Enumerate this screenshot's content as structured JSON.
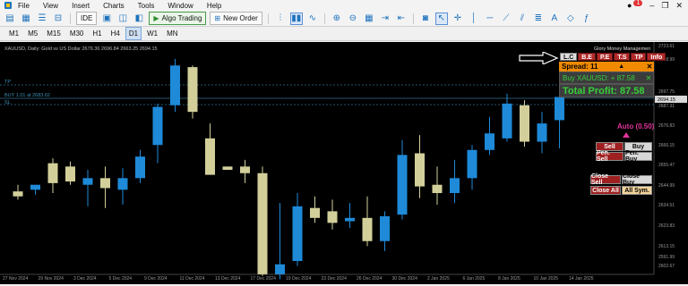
{
  "menu": {
    "items": [
      "File",
      "View",
      "Insert",
      "Charts",
      "Tools",
      "Window",
      "Help"
    ],
    "notification_count": "1"
  },
  "toolbar": {
    "ide_label": "IDE",
    "algo_trading_label": "Algo Trading",
    "new_order_label": "New Order"
  },
  "timeframes": {
    "items": [
      "M1",
      "M5",
      "M15",
      "M30",
      "H1",
      "H4",
      "D1",
      "W1",
      "MN"
    ],
    "active": "D1"
  },
  "chart": {
    "header": "XAUUSD, Daily: Gold vs US Dollar 2679.36 2696.84 2663.25 2694.15",
    "ea_name": "Glory Money Managemen",
    "tp_label": "TP",
    "buy_line_label": "BUY 1.01 at 2683.62",
    "sl_label": "SL",
    "current_price_tag": "2694.15",
    "price_labels": [
      "2723.61",
      "2718.99",
      "2697.75",
      "2687.31",
      "2676.83",
      "2666.15",
      "2655.47",
      "2644.99",
      "2634.51",
      "2623.83",
      "2613.15",
      "2602.67",
      "2591.99"
    ],
    "date_labels": [
      "27 Nov 2024",
      "29 Nov 2024",
      "3 Dec 2024",
      "5 Dec 2024",
      "9 Dec 2024",
      "11 Dec 2024",
      "13 Dec 2024",
      "17 Dec 2024",
      "19 Dec 2024",
      "23 Dec 2024",
      "26 Dec 2024",
      "30 Dec 2024",
      "2 Jan 2025",
      "6 Jan 2025",
      "8 Jan 2025",
      "10 Jan 2025",
      "14 Jan 2025"
    ],
    "colors": {
      "bull": "#1e8ad8",
      "bear": "#d2cf9a",
      "background": "#000000",
      "tp_line": "#2f6f8f",
      "buy_line": "#2f6f8f"
    }
  },
  "chart_data": {
    "type": "candlestick",
    "ylim": [
      2588,
      2725
    ],
    "candles": [
      {
        "o": 2637,
        "h": 2641,
        "l": 2632,
        "c": 2634
      },
      {
        "o": 2638,
        "h": 2640,
        "l": 2635,
        "c": 2641
      },
      {
        "o": 2654,
        "h": 2657,
        "l": 2636,
        "c": 2642
      },
      {
        "o": 2652,
        "h": 2655,
        "l": 2641,
        "c": 2643
      },
      {
        "o": 2641,
        "h": 2650,
        "l": 2628,
        "c": 2645
      },
      {
        "o": 2645,
        "h": 2652,
        "l": 2627,
        "c": 2639
      },
      {
        "o": 2638,
        "h": 2651,
        "l": 2629,
        "c": 2645
      },
      {
        "o": 2645,
        "h": 2662,
        "l": 2642,
        "c": 2658
      },
      {
        "o": 2665,
        "h": 2690,
        "l": 2654,
        "c": 2688
      },
      {
        "o": 2689,
        "h": 2717,
        "l": 2685,
        "c": 2713
      },
      {
        "o": 2712,
        "h": 2713,
        "l": 2681,
        "c": 2685
      },
      {
        "o": 2669,
        "h": 2678,
        "l": 2652,
        "c": 2647
      },
      {
        "o": 2652,
        "h": 2652,
        "l": 2650,
        "c": 2650
      },
      {
        "o": 2652,
        "h": 2656,
        "l": 2642,
        "c": 2648
      },
      {
        "o": 2648,
        "h": 2652,
        "l": 2586,
        "c": 2587
      },
      {
        "o": 2587,
        "h": 2630,
        "l": 2584,
        "c": 2593
      },
      {
        "o": 2595,
        "h": 2636,
        "l": 2592,
        "c": 2628
      },
      {
        "o": 2627,
        "h": 2634,
        "l": 2618,
        "c": 2621
      },
      {
        "o": 2625,
        "h": 2632,
        "l": 2614,
        "c": 2618
      },
      {
        "o": 2619,
        "h": 2630,
        "l": 2615,
        "c": 2621
      },
      {
        "o": 2621,
        "h": 2634,
        "l": 2604,
        "c": 2607
      },
      {
        "o": 2607,
        "h": 2625,
        "l": 2601,
        "c": 2622
      },
      {
        "o": 2623,
        "h": 2668,
        "l": 2620,
        "c": 2659
      },
      {
        "o": 2660,
        "h": 2671,
        "l": 2633,
        "c": 2640
      },
      {
        "o": 2641,
        "h": 2652,
        "l": 2629,
        "c": 2636
      },
      {
        "o": 2636,
        "h": 2656,
        "l": 2630,
        "c": 2645
      },
      {
        "o": 2645,
        "h": 2665,
        "l": 2638,
        "c": 2662
      },
      {
        "o": 2662,
        "h": 2682,
        "l": 2659,
        "c": 2672
      },
      {
        "o": 2669,
        "h": 2696,
        "l": 2667,
        "c": 2690
      },
      {
        "o": 2689,
        "h": 2692,
        "l": 2664,
        "c": 2667
      },
      {
        "o": 2667,
        "h": 2685,
        "l": 2660,
        "c": 2678
      },
      {
        "o": 2680,
        "h": 2697,
        "l": 2663,
        "c": 2694
      }
    ]
  },
  "panel": {
    "tabs": [
      "L.C",
      "B.E",
      "P.E",
      "T.S",
      "TP",
      "Info"
    ],
    "spread_label": "Spread: 11",
    "up_arrow": "▲",
    "close_x": "✕",
    "position_label": "Buy XAUUSD: + 87.58",
    "total_profit_label": "Total Profit: 87.58",
    "auto_label": "Auto (0.50)",
    "buttons": {
      "sell": "Sell",
      "buy": "Buy",
      "pen_sell": "Pen. Sell",
      "pen_buy": "Pen. Buy",
      "close_sell": "Close Sell",
      "close_buy": "Close Buy",
      "close_all": "Close All",
      "all_sym": "All Sym."
    }
  }
}
